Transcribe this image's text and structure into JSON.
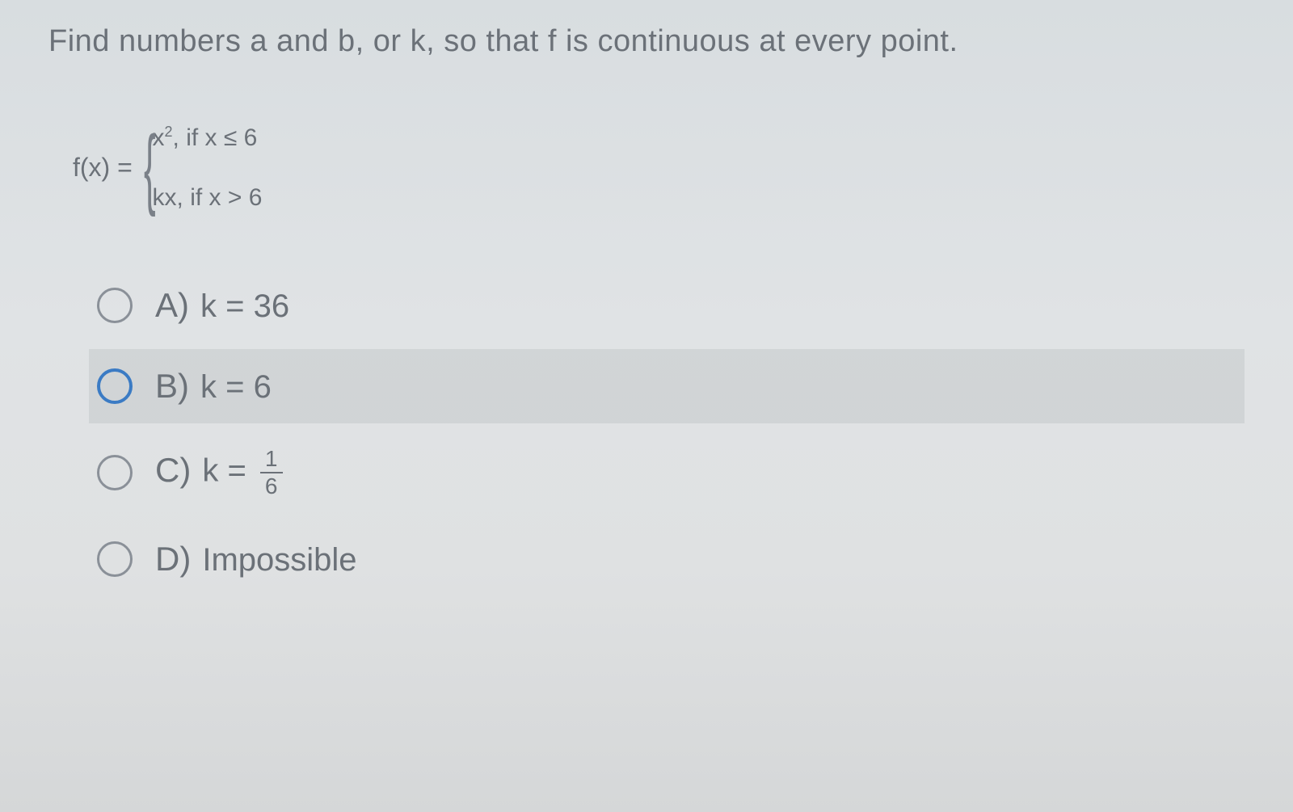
{
  "question": "Find numbers a and b, or k, so that f is continuous at every point.",
  "function": {
    "label": "f(x) =",
    "piece1_expr": "x",
    "piece1_sup": "2",
    "piece1_cond": ",  if x ≤ 6",
    "piece2_expr": "kx",
    "piece2_cond": ",  if x > 6"
  },
  "options": {
    "a": {
      "letter": "A)",
      "text": "k = 36"
    },
    "b": {
      "letter": "B)",
      "text": "k = 6"
    },
    "c": {
      "letter": "C)",
      "prefix": "k = ",
      "frac_num": "1",
      "frac_den": "6"
    },
    "d": {
      "letter": "D)",
      "text": "Impossible"
    }
  }
}
